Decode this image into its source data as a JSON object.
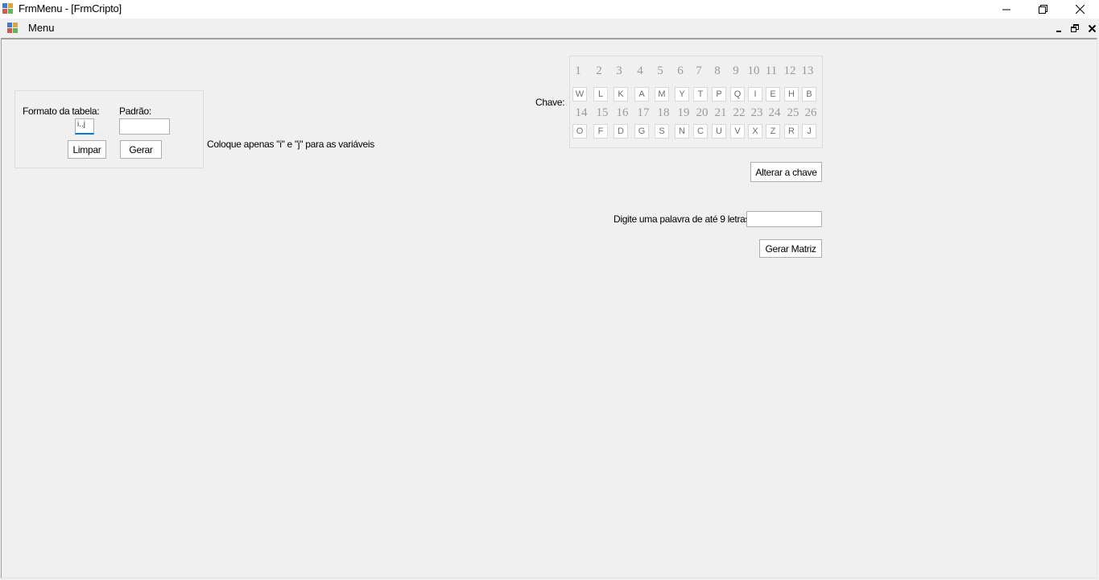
{
  "window": {
    "title": "FrmMenu - [FrmCripto]",
    "minimize_glyph": "—",
    "restore_glyph": "❐",
    "close_glyph": "✕"
  },
  "menubar": {
    "menu_label": "Menu",
    "mdi_minimize_glyph": "_",
    "mdi_restore_glyph": "🗗",
    "mdi_close_glyph": "✕"
  },
  "table_group": {
    "format_label": "Formato da tabela:",
    "format_value": "i..j",
    "pattern_label": "Padrão:",
    "pattern_value": "",
    "clear_button": "Limpar",
    "generate_button": "Gerar"
  },
  "hint": "Coloque apenas \"i\" e \"j\" para as variáveis",
  "key": {
    "label": "Chave:",
    "row1_numbers": [
      "1",
      "2",
      "3",
      "4",
      "5",
      "6",
      "7",
      "8",
      "9",
      "10",
      "11",
      "12",
      "13"
    ],
    "row1_letters": [
      "W",
      "L",
      "K",
      "A",
      "M",
      "Y",
      "T",
      "P",
      "Q",
      "I",
      "E",
      "H",
      "B"
    ],
    "row2_numbers": [
      "14",
      "15",
      "16",
      "17",
      "18",
      "19",
      "20",
      "21",
      "22",
      "23",
      "24",
      "25",
      "26"
    ],
    "row2_letters": [
      "O",
      "F",
      "D",
      "G",
      "S",
      "N",
      "C",
      "U",
      "V",
      "X",
      "Z",
      "R",
      "J"
    ],
    "change_button": "Alterar a chave"
  },
  "word": {
    "label": "Digite uma palavra de até 9 letras:",
    "value": "",
    "matrix_button": "Gerar Matriz"
  }
}
